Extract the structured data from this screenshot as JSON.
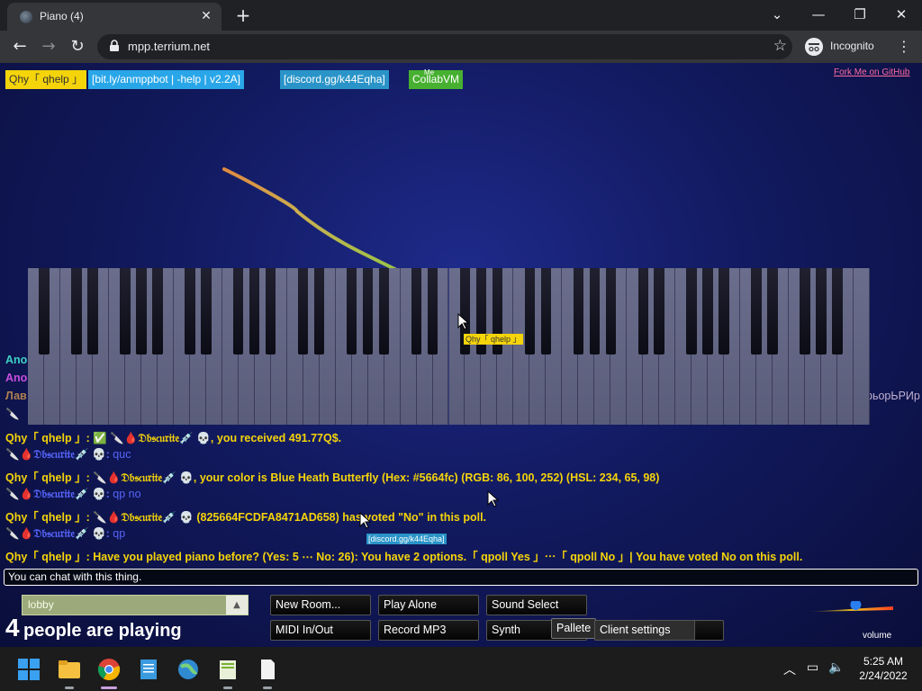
{
  "browser": {
    "tab_title": "Piano (4)",
    "url": "mpp.terrium.net",
    "profile_label": "Incognito"
  },
  "topbar": {
    "buttons": [
      {
        "label": "Qhy「 qhelp 」",
        "bg": "#f5d40a",
        "fg": "#333333"
      },
      {
        "label": "[bit.ly/anmppbot | -help | v2.2A]",
        "bg": "#29a6e8",
        "fg": "#ffffff"
      },
      {
        "label": "[discord.gg/k44Eqha]",
        "bg": "#2a94c8",
        "fg": "#ffffff"
      },
      {
        "label": "CollabVM",
        "bg": "#47b030",
        "fg": "#ffffff",
        "overlay": "Me"
      }
    ],
    "fork_link": "Fork Me on GitHub"
  },
  "cursor_tags": [
    {
      "label": "Qhy「 qhelp 」",
      "bg": "#f5d40a",
      "fg": "#333333"
    },
    {
      "label": "[discord.gg/k44Eqha]",
      "bg": "#2a94c8",
      "fg": "#ffffff"
    }
  ],
  "chat": {
    "partial": [
      {
        "text": "Ano",
        "color": "#3fd1c4"
      },
      {
        "text": "Ano",
        "color": "#c84fe0"
      },
      {
        "text": "Лав",
        "color": "#b08050"
      },
      {
        "text": "рьорЬРИр",
        "color": "#c0b0d0"
      }
    ],
    "messages": [
      {
        "name": "Qhy「 qhelp 」:",
        "name_color": "#f5d40a",
        "text": "✅ 🔪🩸𝔇𝔟𝔰𝔠𝔲𝔯𝔦𝔱𝔢💉 💀, you received 491.77Q$.",
        "text_color": "#f5d40a"
      },
      {
        "name": "🔪🩸𝔇𝔟𝔰𝔠𝔲𝔯𝔦𝔱𝔢💉 💀:",
        "name_color": "#5664fc",
        "text": "quc",
        "text_color": "#5664fc"
      },
      {
        "name": "Qhy「 qhelp 」:",
        "name_color": "#f5d40a",
        "text": "🔪🩸𝔇𝔟𝔰𝔠𝔲𝔯𝔦𝔱𝔢💉 💀, your color is Blue Heath Butterfly (Hex: #5664fc) (RGB: 86, 100, 252) (HSL: 234, 65, 98)",
        "text_color": "#f5d40a"
      },
      {
        "name": "🔪🩸𝔇𝔟𝔰𝔠𝔲𝔯𝔦𝔱𝔢💉 💀:",
        "name_color": "#5664fc",
        "text": "qp no",
        "text_color": "#5664fc"
      },
      {
        "name": "Qhy「 qhelp 」:",
        "name_color": "#f5d40a",
        "text": "🔪🩸𝔇𝔟𝔰𝔠𝔲𝔯𝔦𝔱𝔢💉 💀 (825664FCDFA8471AD658) has voted \"No\" in this poll.",
        "text_color": "#f5d40a"
      },
      {
        "name": "🔪🩸𝔇𝔟𝔰𝔠𝔲𝔯𝔦𝔱𝔢💉 💀:",
        "name_color": "#5664fc",
        "text": "qp",
        "text_color": "#5664fc"
      },
      {
        "name": "Qhy「 qhelp 」:",
        "name_color": "#f5d40a",
        "text": "Have you played piano before? (Yes: 5 ⋯ No: 26): You have 2 options.「 qpoll Yes 」⋯「 qpoll No 」| You have voted No on this poll.",
        "text_color": "#f5d40a"
      }
    ],
    "input_placeholder": "You can chat with this thing."
  },
  "bottom": {
    "room_name": "lobby",
    "player_count": "4",
    "player_count_text": "people are playing",
    "buttons": {
      "new_room": "New Room...",
      "play_alone": "Play Alone",
      "sound_select": "Sound Select",
      "midi": "MIDI In/Out",
      "record": "Record MP3",
      "synth": "Synth",
      "pallete": "Pallete",
      "client_settings": "Client settings"
    },
    "volume_label": "volume",
    "volume_level": 0.55
  },
  "taskbar": {
    "time": "5:25 AM",
    "date": "2/24/2022"
  },
  "colors": {
    "accent_yellow": "#f5d40a",
    "user_blue": "#5664fc",
    "chat_bg": "#0a0e3a"
  }
}
